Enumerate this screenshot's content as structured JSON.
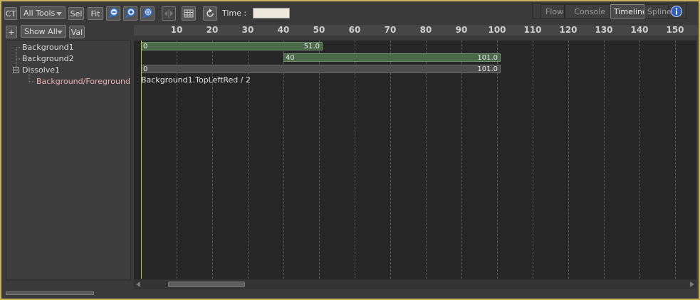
{
  "toolbar": {
    "ct_label": "CT",
    "all_tools_label": "All Tools",
    "sel_label": "Sel",
    "fit_label": "Fit",
    "time_label": "Time :",
    "time_value": ""
  },
  "toolbar2": {
    "add_label": "+",
    "show_all_label": "Show All",
    "val_label": "Val"
  },
  "tabs": {
    "flow": "Flow",
    "console": "Console",
    "timeline": "Timeline",
    "spline": "Spline"
  },
  "tree": {
    "items": [
      {
        "label": "Background1"
      },
      {
        "label": "Background2"
      },
      {
        "label": "Dissolve1"
      },
      {
        "label": "Background/Foreground"
      }
    ]
  },
  "ruler": {
    "ticks": [
      "10",
      "20",
      "30",
      "40",
      "50",
      "60",
      "70",
      "80",
      "90",
      "100",
      "110",
      "120",
      "130",
      "140",
      "150"
    ]
  },
  "tracks": [
    {
      "start_label": "0",
      "end_label": "51.0",
      "start": 0,
      "end": 51.0
    },
    {
      "start_label": "40",
      "end_label": "101.0",
      "start": 40,
      "end": 101.0
    },
    {
      "start_label": "0",
      "end_label": "101.0",
      "start": 0,
      "end": 101.0
    }
  ],
  "connection_label": "Background1.TopLeftRed / 2",
  "colors": {
    "frame_border": "#c9b15a",
    "clip_green": "#4a6a4a",
    "clip_grey": "#4d4d4d",
    "playhead": "#b8c830",
    "child_label": "#e8b0b0"
  }
}
